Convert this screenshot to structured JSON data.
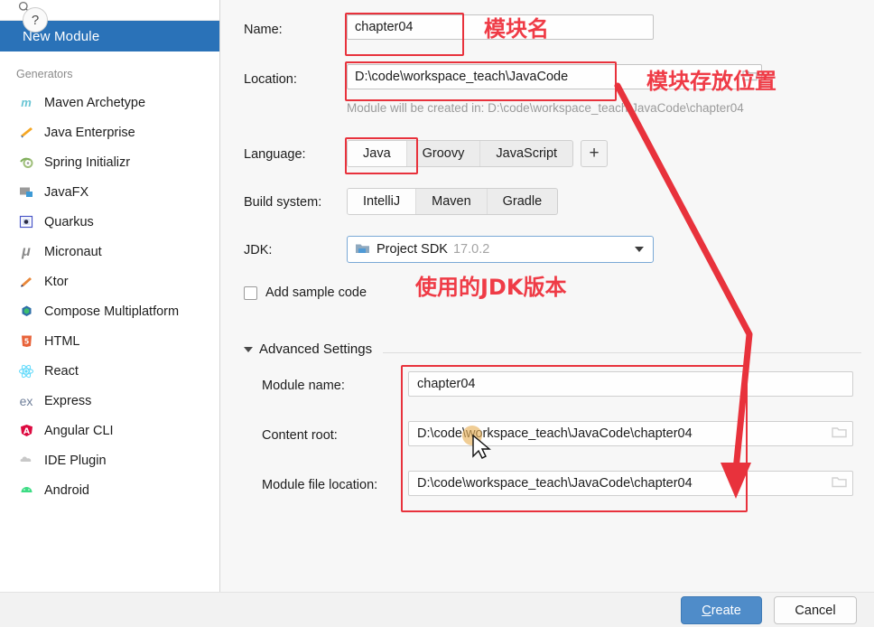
{
  "sidebar": {
    "search_placeholder": "",
    "selected_item": "New Module",
    "group_label": "Generators",
    "generators": [
      {
        "label": "Maven Archetype",
        "icon": "maven-icon",
        "glyph": "m",
        "color": "#6ac5d4"
      },
      {
        "label": "Java Enterprise",
        "icon": "java-enterprise-icon",
        "glyph": "◢",
        "color": "#f5a623"
      },
      {
        "label": "Spring Initializr",
        "icon": "spring-icon",
        "glyph": "❦",
        "color": "#9fbf7a"
      },
      {
        "label": "JavaFX",
        "icon": "javafx-icon",
        "glyph": "▰",
        "color": "#9a9a9a"
      },
      {
        "label": "Quarkus",
        "icon": "quarkus-icon",
        "glyph": "◉",
        "color": "#4b58c8"
      },
      {
        "label": "Micronaut",
        "icon": "micronaut-icon",
        "glyph": "μ",
        "color": "#8a8a8a"
      },
      {
        "label": "Ktor",
        "icon": "ktor-icon",
        "glyph": "◆",
        "color": "#e8873a"
      },
      {
        "label": "Compose Multiplatform",
        "icon": "compose-icon",
        "glyph": "⬢",
        "color": "#2f6fa8"
      },
      {
        "label": "HTML",
        "icon": "html-icon",
        "glyph": "5",
        "color": "#e8633a"
      },
      {
        "label": "React",
        "icon": "react-icon",
        "glyph": "⚛",
        "color": "#61dafb"
      },
      {
        "label": "Express",
        "icon": "express-icon",
        "glyph": "ex",
        "color": "#6f7f9a"
      },
      {
        "label": "Angular CLI",
        "icon": "angular-icon",
        "glyph": "A",
        "color": "#dd0a40"
      },
      {
        "label": "IDE Plugin",
        "icon": "ide-plugin-icon",
        "glyph": "☁",
        "color": "#b5b5b5"
      },
      {
        "label": "Android",
        "icon": "android-icon",
        "glyph": "▰",
        "color": "#3ddc84"
      }
    ]
  },
  "form": {
    "name_label": "Name:",
    "name_value": "chapter04",
    "location_label": "Location:",
    "location_value": "D:\\code\\workspace_teach\\JavaCode",
    "location_hint": "Module will be created in: D:\\code\\workspace_teach\\JavaCode\\chapter04",
    "language_label": "Language:",
    "language_options": [
      "Java",
      "Groovy",
      "JavaScript"
    ],
    "language_selected": "Java",
    "language_add_label": "+",
    "build_system_label": "Build system:",
    "build_system_options": [
      "IntelliJ",
      "Maven",
      "Gradle"
    ],
    "build_system_selected": "IntelliJ",
    "jdk_label": "JDK:",
    "jdk_value": "Project SDK",
    "jdk_version": "17.0.2",
    "sample_code_label": "Add sample code",
    "sample_code_checked": false
  },
  "advanced": {
    "title": "Advanced Settings",
    "module_name_label": "Module name:",
    "module_name_value": "chapter04",
    "content_root_label": "Content root:",
    "content_root_value": "D:\\code\\workspace_teach\\JavaCode\\chapter04",
    "module_file_label": "Module file location:",
    "module_file_value": "D:\\code\\workspace_teach\\JavaCode\\chapter04"
  },
  "footer": {
    "help_label": "?",
    "create_mnemonic": "C",
    "create_rest": "reate",
    "cancel_label": "Cancel"
  },
  "annotations": {
    "module_name_note": "模块名",
    "location_note": "模块存放位置",
    "jdk_note": "使用的JDK版本",
    "highlight_color": "#e8323c",
    "note_color": "#ef3b46"
  }
}
